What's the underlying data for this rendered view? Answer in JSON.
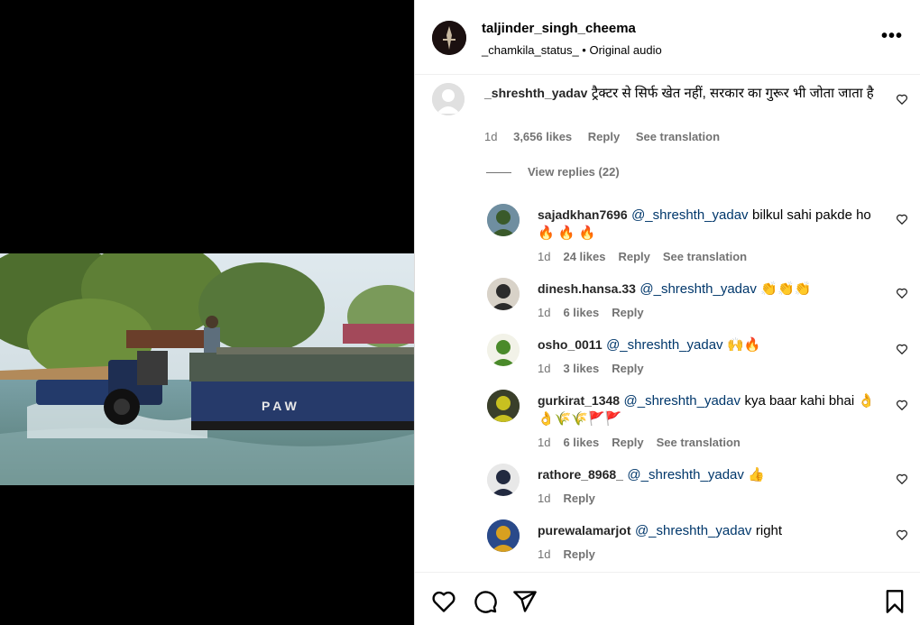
{
  "post": {
    "username": "taljinder_singh_cheema",
    "audio_user": "_chamkila_status_",
    "audio_sep": "•",
    "audio_label": "Original audio",
    "more_icon": "more-horizontal-icon"
  },
  "video": {
    "vehicle_text": "PAW"
  },
  "main_comment": {
    "user": "_shreshth_yadav",
    "text": "ट्रैक्टर से सिर्फ खेत नहीं, सरकार का गुरूर भी जोता जाता है",
    "age": "1d",
    "likes": "3,656 likes",
    "reply": "Reply",
    "translate": "See translation",
    "view_replies": "View replies (22)"
  },
  "replies": [
    {
      "user": "sajadkhan7696",
      "mention": "@_shreshth_yadav",
      "text": "bilkul sahi pakde ho 🔥 🔥 🔥",
      "age": "1d",
      "likes": "24 likes",
      "reply": "Reply",
      "translate": "See translation"
    },
    {
      "user": "dinesh.hansa.33",
      "mention": "@_shreshth_yadav",
      "text": "👏👏👏",
      "age": "1d",
      "likes": "6 likes",
      "reply": "Reply",
      "translate": ""
    },
    {
      "user": "osho_0011",
      "mention": "@_shreshth_yadav",
      "text": "🙌🔥",
      "age": "1d",
      "likes": "3 likes",
      "reply": "Reply",
      "translate": ""
    },
    {
      "user": "gurkirat_1348",
      "mention": "@_shreshth_yadav",
      "text": "kya baar kahi bhai 👌👌🌾🌾🚩🚩",
      "age": "1d",
      "likes": "6 likes",
      "reply": "Reply",
      "translate": "See translation"
    },
    {
      "user": "rathore_8968_",
      "mention": "@_shreshth_yadav",
      "text": "👍",
      "age": "1d",
      "likes": "",
      "reply": "Reply",
      "translate": ""
    },
    {
      "user": "purewalamarjot",
      "mention": "@_shreshth_yadav",
      "text": "right",
      "age": "1d",
      "likes": "",
      "reply": "Reply",
      "translate": ""
    }
  ],
  "actions": {
    "like_icon": "heart-icon",
    "comment_icon": "comment-icon",
    "share_icon": "share-icon",
    "save_icon": "bookmark-icon"
  }
}
